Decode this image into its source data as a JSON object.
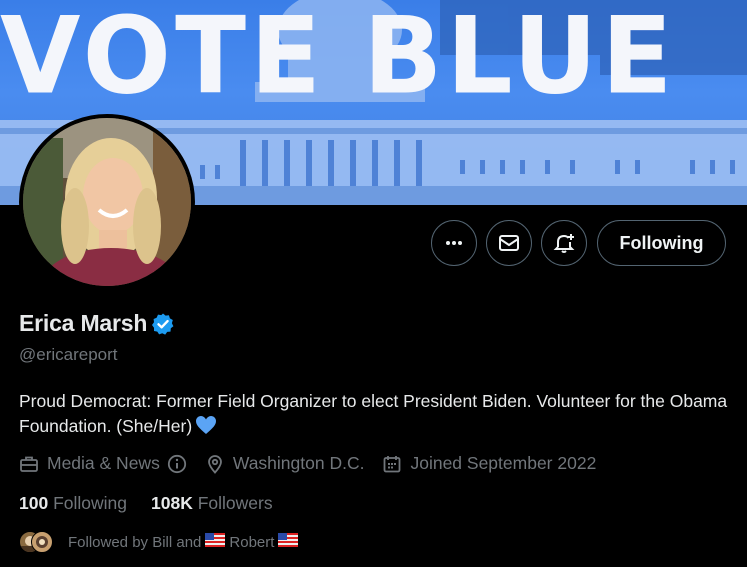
{
  "banner": {
    "word1": "VOTE",
    "word2": "BLUE",
    "bg_color": "#3f7fe2"
  },
  "profile": {
    "display_name": "Erica Marsh",
    "handle": "@ericareport",
    "bio": "Proud Democrat: Former Field Organizer to elect President Biden. Volunteer for the Obama Foundation. (She/Her)",
    "verified_color": "#1d9bf0"
  },
  "actions": {
    "more_icon": "more-icon",
    "message_icon": "envelope-icon",
    "notify_icon": "bell-plus-icon",
    "following_label": "Following"
  },
  "meta": {
    "category": "Media & News",
    "location": "Washington D.C.",
    "joined": "Joined September 2022"
  },
  "stats": {
    "following_count": "100",
    "following_label": "Following",
    "followers_count": "108K",
    "followers_label": "Followers"
  },
  "followed_by": {
    "prefix": "Followed by Bill and",
    "name2": "Robert"
  },
  "colors": {
    "text_primary": "#e7e9ea",
    "text_secondary": "#71767b",
    "border": "#536471",
    "heart": "#5ba4f5"
  }
}
